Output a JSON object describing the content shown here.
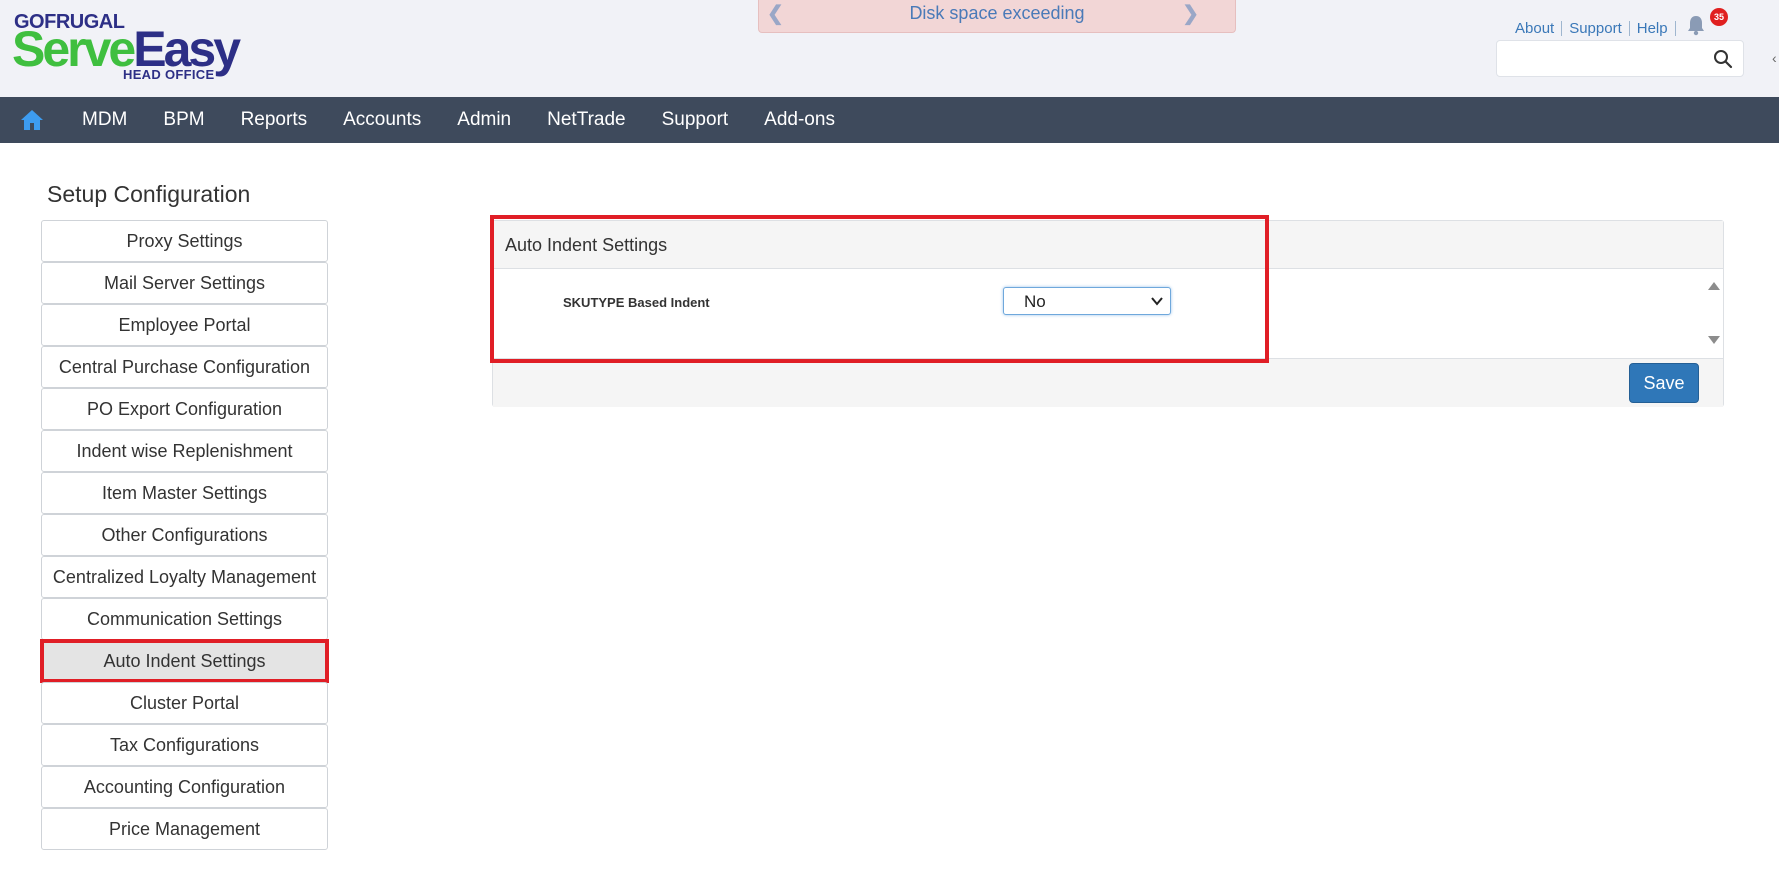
{
  "brand": {
    "top": "GOFRUGAL",
    "serve": "Serve",
    "easy": "Easy",
    "sub": "HEAD OFFICE"
  },
  "notice": {
    "text": "Disk space exceeding",
    "prev_icon": "chevron-left-icon",
    "next_icon": "chevron-right-icon"
  },
  "toplinks": {
    "about": "About",
    "support": "Support",
    "help": "Help"
  },
  "notifications": {
    "count": "35",
    "icon": "bell-icon"
  },
  "search": {
    "value": "",
    "placeholder": "",
    "icon": "search-icon"
  },
  "nav": {
    "home_icon": "home-icon",
    "items": [
      "MDM",
      "BPM",
      "Reports",
      "Accounts",
      "Admin",
      "NetTrade",
      "Support",
      "Add-ons"
    ]
  },
  "sidebar": {
    "title": "Setup Configuration",
    "items": [
      "Proxy Settings",
      "Mail Server Settings",
      "Employee Portal",
      "Central Purchase Configuration",
      "PO Export Configuration",
      "Indent wise Replenishment",
      "Item Master Settings",
      "Other Configurations",
      "Centralized Loyalty Management",
      "Communication Settings",
      "Auto Indent Settings",
      "Cluster Portal",
      "Tax Configurations",
      "Accounting Configuration",
      "Price Management"
    ],
    "active_index": 10
  },
  "panel": {
    "title": "Auto Indent Settings",
    "field_label": "SKUTYPE Based Indent",
    "select_value": "No",
    "save_label": "Save"
  },
  "colors": {
    "nav_bg": "#3e4a5c",
    "highlight": "#e01e26",
    "save_button": "#2f77b8",
    "link": "#3a78b8"
  }
}
